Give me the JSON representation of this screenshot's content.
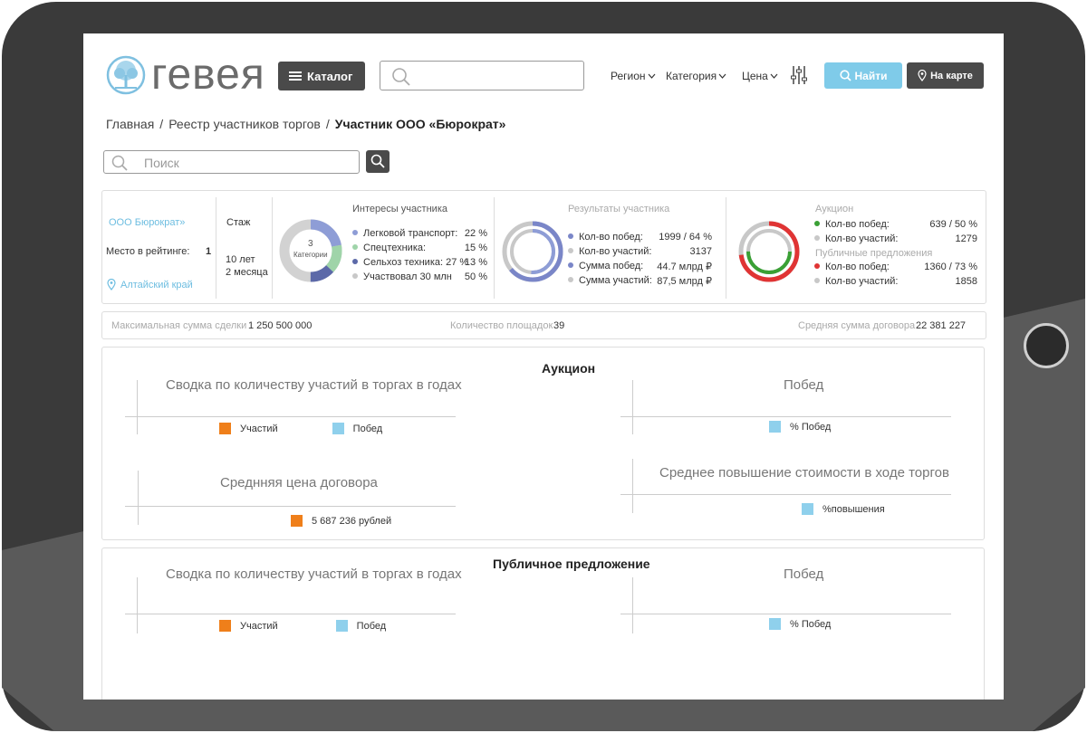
{
  "logo": {
    "text": "гевея"
  },
  "header": {
    "catalog_label": "Каталог",
    "search_placeholder": "",
    "filters": [
      "Регион",
      "Категория",
      "Цена"
    ],
    "find_label": "Найти",
    "map_label": "На карте"
  },
  "breadcrumbs": [
    "Главная",
    "Реестр участников торгов",
    "Участник ООО «Бюрократ»"
  ],
  "page_search": {
    "placeholder": "Поиск"
  },
  "participant": {
    "name": "ООО Бюрократ»",
    "rating_label": "Место в рейтинге:",
    "rating_value": "1",
    "region": "Алтайский край",
    "experience_label": "Стаж",
    "experience_years": "10 лет",
    "experience_months": "2 месяца"
  },
  "interests": {
    "title": "Интересы участника",
    "center_count": "3",
    "center_label": "Категории",
    "rows": [
      {
        "label": "Легковой транспорт:",
        "value": "22 %",
        "color": "#8e9dd6"
      },
      {
        "label": "Спецтехника:",
        "value": "15 %",
        "color": "#9fd4a9"
      },
      {
        "label": "Сельхоз техника: 27 %",
        "value": "13 %",
        "color": "#5c69a8"
      },
      {
        "label": "Участвовал 30 млн",
        "value": "50 %",
        "color": "#c8c8c8"
      }
    ]
  },
  "results": {
    "title": "Результаты участника",
    "rows": [
      {
        "label": "Кол-во побед:",
        "value": "1999 / 64 %",
        "color": "#7a86c8"
      },
      {
        "label": "Кол-во участий:",
        "value": "3137",
        "color": "#c8c8c8"
      },
      {
        "label": "Сумма побед:",
        "value": "44.7 млрд ₽",
        "color": "#7a86c8"
      },
      {
        "label": "Сумма участий:",
        "value": "87,5 млрд ₽",
        "color": "#c8c8c8"
      }
    ]
  },
  "auction": {
    "title": "Аукцион",
    "rows": [
      {
        "label": "Кол-во побед:",
        "value": "639 / 50 %",
        "color": "#3aa035"
      },
      {
        "label": "Кол-во участий:",
        "value": "1279",
        "color": "#c8c8c8"
      }
    ],
    "public_title": "Публичные  предложения",
    "public_rows": [
      {
        "label": "Кол-во побед:",
        "value": "1360 / 73 %",
        "color": "#e03434"
      },
      {
        "label": "Кол-во участий:",
        "value": "1858",
        "color": "#c8c8c8"
      }
    ]
  },
  "summary": {
    "max_deal_label": "Максимальная сумма сделки",
    "max_deal_value": "1 250 500 000",
    "platforms_label": "Количество площадок",
    "platforms_value": "39",
    "avg_contract_label": "Средняя сумма договора",
    "avg_contract_value": "22 381 227"
  },
  "auction_section": {
    "title": "Аукцион",
    "chart1_title": "Сводка по количеству участий в торгах в годах",
    "chart1_legend": [
      "Участий",
      "Побед"
    ],
    "chart2_title": "Побед",
    "chart2_legend": "% Побед",
    "chart3_title": "Среднняя цена договора",
    "chart3_legend": "5 687 236 рублей",
    "chart4_title": "Среднее повышение стоимости в ходе торгов",
    "chart4_legend": "%повышения"
  },
  "public_section": {
    "title": "Публичное предложение",
    "chart1_title": "Сводка по количеству участий в торгах в годах",
    "chart1_legend": [
      "Участий",
      "Побед"
    ],
    "chart2_title": "Побед",
    "chart2_legend": "% Побед"
  },
  "colors": {
    "orange": "#ef7f1a",
    "light_blue": "#8fd0ec",
    "dark": "#4a4a4a",
    "accent": "#7fcbe9"
  }
}
